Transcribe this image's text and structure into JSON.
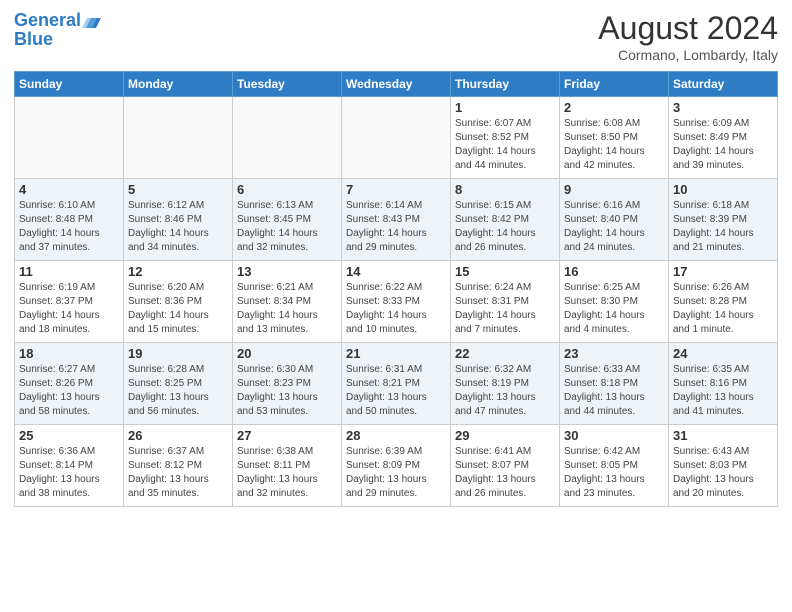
{
  "header": {
    "logo_line1": "General",
    "logo_line2": "Blue",
    "month": "August 2024",
    "location": "Cormano, Lombardy, Italy"
  },
  "weekdays": [
    "Sunday",
    "Monday",
    "Tuesday",
    "Wednesday",
    "Thursday",
    "Friday",
    "Saturday"
  ],
  "weeks": [
    [
      {
        "day": "",
        "info": ""
      },
      {
        "day": "",
        "info": ""
      },
      {
        "day": "",
        "info": ""
      },
      {
        "day": "",
        "info": ""
      },
      {
        "day": "1",
        "info": "Sunrise: 6:07 AM\nSunset: 8:52 PM\nDaylight: 14 hours\nand 44 minutes."
      },
      {
        "day": "2",
        "info": "Sunrise: 6:08 AM\nSunset: 8:50 PM\nDaylight: 14 hours\nand 42 minutes."
      },
      {
        "day": "3",
        "info": "Sunrise: 6:09 AM\nSunset: 8:49 PM\nDaylight: 14 hours\nand 39 minutes."
      }
    ],
    [
      {
        "day": "4",
        "info": "Sunrise: 6:10 AM\nSunset: 8:48 PM\nDaylight: 14 hours\nand 37 minutes."
      },
      {
        "day": "5",
        "info": "Sunrise: 6:12 AM\nSunset: 8:46 PM\nDaylight: 14 hours\nand 34 minutes."
      },
      {
        "day": "6",
        "info": "Sunrise: 6:13 AM\nSunset: 8:45 PM\nDaylight: 14 hours\nand 32 minutes."
      },
      {
        "day": "7",
        "info": "Sunrise: 6:14 AM\nSunset: 8:43 PM\nDaylight: 14 hours\nand 29 minutes."
      },
      {
        "day": "8",
        "info": "Sunrise: 6:15 AM\nSunset: 8:42 PM\nDaylight: 14 hours\nand 26 minutes."
      },
      {
        "day": "9",
        "info": "Sunrise: 6:16 AM\nSunset: 8:40 PM\nDaylight: 14 hours\nand 24 minutes."
      },
      {
        "day": "10",
        "info": "Sunrise: 6:18 AM\nSunset: 8:39 PM\nDaylight: 14 hours\nand 21 minutes."
      }
    ],
    [
      {
        "day": "11",
        "info": "Sunrise: 6:19 AM\nSunset: 8:37 PM\nDaylight: 14 hours\nand 18 minutes."
      },
      {
        "day": "12",
        "info": "Sunrise: 6:20 AM\nSunset: 8:36 PM\nDaylight: 14 hours\nand 15 minutes."
      },
      {
        "day": "13",
        "info": "Sunrise: 6:21 AM\nSunset: 8:34 PM\nDaylight: 14 hours\nand 13 minutes."
      },
      {
        "day": "14",
        "info": "Sunrise: 6:22 AM\nSunset: 8:33 PM\nDaylight: 14 hours\nand 10 minutes."
      },
      {
        "day": "15",
        "info": "Sunrise: 6:24 AM\nSunset: 8:31 PM\nDaylight: 14 hours\nand 7 minutes."
      },
      {
        "day": "16",
        "info": "Sunrise: 6:25 AM\nSunset: 8:30 PM\nDaylight: 14 hours\nand 4 minutes."
      },
      {
        "day": "17",
        "info": "Sunrise: 6:26 AM\nSunset: 8:28 PM\nDaylight: 14 hours\nand 1 minute."
      }
    ],
    [
      {
        "day": "18",
        "info": "Sunrise: 6:27 AM\nSunset: 8:26 PM\nDaylight: 13 hours\nand 58 minutes."
      },
      {
        "day": "19",
        "info": "Sunrise: 6:28 AM\nSunset: 8:25 PM\nDaylight: 13 hours\nand 56 minutes."
      },
      {
        "day": "20",
        "info": "Sunrise: 6:30 AM\nSunset: 8:23 PM\nDaylight: 13 hours\nand 53 minutes."
      },
      {
        "day": "21",
        "info": "Sunrise: 6:31 AM\nSunset: 8:21 PM\nDaylight: 13 hours\nand 50 minutes."
      },
      {
        "day": "22",
        "info": "Sunrise: 6:32 AM\nSunset: 8:19 PM\nDaylight: 13 hours\nand 47 minutes."
      },
      {
        "day": "23",
        "info": "Sunrise: 6:33 AM\nSunset: 8:18 PM\nDaylight: 13 hours\nand 44 minutes."
      },
      {
        "day": "24",
        "info": "Sunrise: 6:35 AM\nSunset: 8:16 PM\nDaylight: 13 hours\nand 41 minutes."
      }
    ],
    [
      {
        "day": "25",
        "info": "Sunrise: 6:36 AM\nSunset: 8:14 PM\nDaylight: 13 hours\nand 38 minutes."
      },
      {
        "day": "26",
        "info": "Sunrise: 6:37 AM\nSunset: 8:12 PM\nDaylight: 13 hours\nand 35 minutes."
      },
      {
        "day": "27",
        "info": "Sunrise: 6:38 AM\nSunset: 8:11 PM\nDaylight: 13 hours\nand 32 minutes."
      },
      {
        "day": "28",
        "info": "Sunrise: 6:39 AM\nSunset: 8:09 PM\nDaylight: 13 hours\nand 29 minutes."
      },
      {
        "day": "29",
        "info": "Sunrise: 6:41 AM\nSunset: 8:07 PM\nDaylight: 13 hours\nand 26 minutes."
      },
      {
        "day": "30",
        "info": "Sunrise: 6:42 AM\nSunset: 8:05 PM\nDaylight: 13 hours\nand 23 minutes."
      },
      {
        "day": "31",
        "info": "Sunrise: 6:43 AM\nSunset: 8:03 PM\nDaylight: 13 hours\nand 20 minutes."
      }
    ]
  ]
}
